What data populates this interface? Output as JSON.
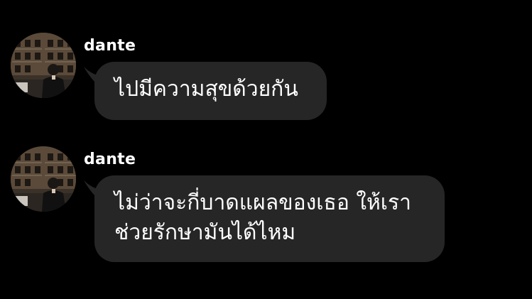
{
  "colors": {
    "background": "#000000",
    "bubble": "#262626",
    "text": "#ffffff"
  },
  "messages": [
    {
      "sender": "dante",
      "avatar_icon": "profile-photo-avatar",
      "lines": [
        "ไปมีความสุขด้วยกัน"
      ]
    },
    {
      "sender": "dante",
      "avatar_icon": "profile-photo-avatar",
      "lines": [
        "ไม่ว่าจะกี่บาดแผลของเธอ ให้เรา",
        "ช่วยรักษามันได้ไหม"
      ]
    }
  ]
}
